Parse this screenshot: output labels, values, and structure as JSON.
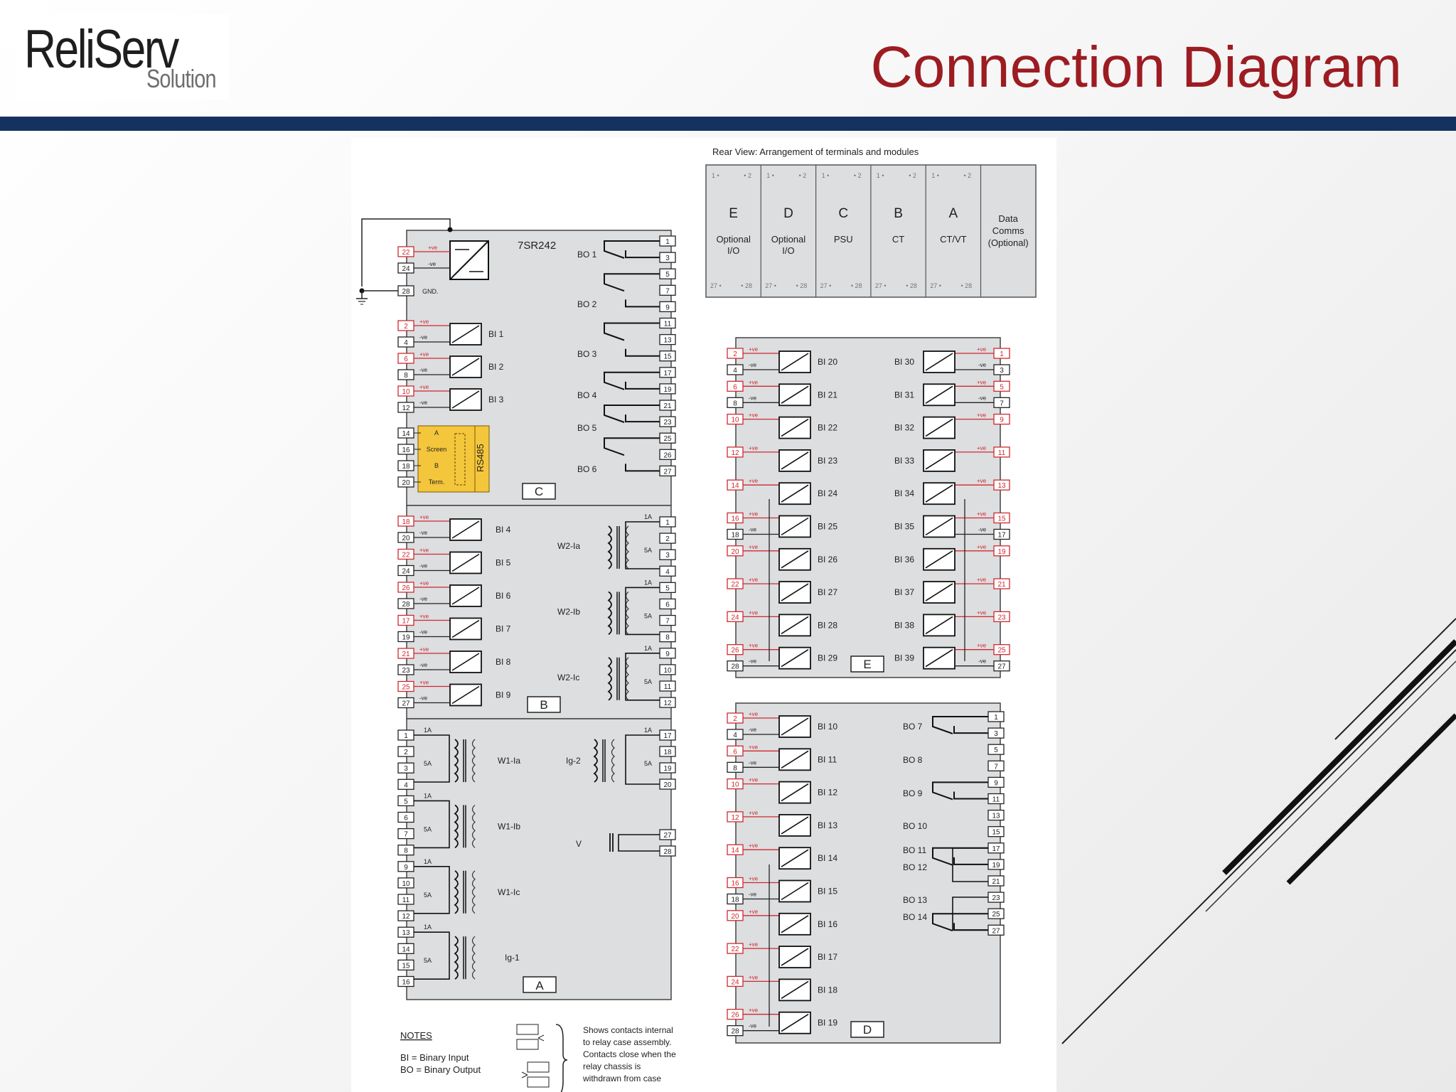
{
  "header": {
    "logo_main": "ReliServ",
    "logo_sub": "Solution",
    "title": "Connection Diagram"
  },
  "rear_view": {
    "caption": "Rear View: Arrangement of terminals and modules",
    "modules": [
      {
        "letter": "E",
        "lines": [
          "Optional",
          "I/O"
        ]
      },
      {
        "letter": "D",
        "lines": [
          "Optional",
          "I/O"
        ]
      },
      {
        "letter": "C",
        "lines": [
          "PSU"
        ]
      },
      {
        "letter": "B",
        "lines": [
          "CT"
        ]
      },
      {
        "letter": "A",
        "lines": [
          "CT/VT"
        ]
      },
      {
        "letter": "",
        "lines": [
          "Data",
          "Comms",
          "(Optional)"
        ]
      }
    ]
  },
  "relay": {
    "model": "7SR242",
    "gnd": "GND.",
    "rs485": "RS485",
    "rs485_terms": [
      {
        "n": "14",
        "t": "A"
      },
      {
        "n": "16",
        "t": "Screen"
      },
      {
        "n": "18",
        "t": "B"
      },
      {
        "n": "20",
        "t": "Term."
      }
    ],
    "psu_terms": [
      "22",
      "24",
      "28"
    ],
    "module_c": {
      "letter": "C",
      "bi": [
        {
          "n": "BI 1",
          "p": "2",
          "m": "4"
        },
        {
          "n": "BI 2",
          "p": "6",
          "m": "8"
        },
        {
          "n": "BI 3",
          "p": "10",
          "m": "12"
        }
      ],
      "bo_labels": [
        "BO 1",
        "BO 2",
        "BO 3",
        "BO 4",
        "BO 5",
        "BO 6"
      ],
      "right_terms": [
        "1",
        "3",
        "5",
        "7",
        "9",
        "11",
        "13",
        "15",
        "17",
        "19",
        "21",
        "23",
        "25",
        "26",
        "27"
      ]
    },
    "module_b": {
      "letter": "B",
      "bi": [
        {
          "n": "BI 4",
          "p": "18",
          "m": "20"
        },
        {
          "n": "BI 5",
          "p": "22",
          "m": "24"
        },
        {
          "n": "BI 6",
          "p": "26",
          "m": "28"
        },
        {
          "n": "BI 7",
          "p": "17",
          "m": "19"
        },
        {
          "n": "BI 8",
          "p": "21",
          "m": "23"
        },
        {
          "n": "BI 9",
          "p": "25",
          "m": "27"
        }
      ],
      "ct": [
        "W2-Ia",
        "W2-Ib",
        "W2-Ic"
      ],
      "right_terms": [
        "1",
        "2",
        "3",
        "4",
        "5",
        "6",
        "7",
        "8",
        "9",
        "10",
        "11",
        "12"
      ]
    },
    "module_a": {
      "letter": "A",
      "ct_left": [
        "W1-Ia",
        "W1-Ib",
        "W1-Ic",
        "Ig-1"
      ],
      "left_terms": [
        "1",
        "2",
        "3",
        "4",
        "5",
        "6",
        "7",
        "8",
        "9",
        "10",
        "11",
        "12",
        "13",
        "14",
        "15",
        "16"
      ],
      "ig2": "Ig-2",
      "v": "V",
      "right_terms": [
        "17",
        "18",
        "19",
        "20",
        "27",
        "28"
      ]
    }
  },
  "module_e": {
    "letter": "E",
    "left": [
      {
        "n": "BI 20",
        "p": "2",
        "m": "4"
      },
      {
        "n": "BI 21",
        "p": "6",
        "m": "8"
      },
      {
        "n": "BI 22",
        "p": "10",
        "m": ""
      },
      {
        "n": "BI 23",
        "p": "12",
        "m": ""
      },
      {
        "n": "BI 24",
        "p": "14",
        "m": ""
      },
      {
        "n": "BI 25",
        "p": "16",
        "m": "18"
      },
      {
        "n": "BI 26",
        "p": "20",
        "m": ""
      },
      {
        "n": "BI 27",
        "p": "22",
        "m": ""
      },
      {
        "n": "BI 28",
        "p": "24",
        "m": ""
      },
      {
        "n": "BI 29",
        "p": "26",
        "m": "28"
      }
    ],
    "right": [
      {
        "n": "BI 30",
        "p": "1",
        "m": "3"
      },
      {
        "n": "BI 31",
        "p": "5",
        "m": "7"
      },
      {
        "n": "BI 32",
        "p": "9",
        "m": ""
      },
      {
        "n": "BI 33",
        "p": "11",
        "m": ""
      },
      {
        "n": "BI 34",
        "p": "13",
        "m": ""
      },
      {
        "n": "BI 35",
        "p": "15",
        "m": "17"
      },
      {
        "n": "BI 36",
        "p": "19",
        "m": ""
      },
      {
        "n": "BI 37",
        "p": "21",
        "m": ""
      },
      {
        "n": "BI 38",
        "p": "23",
        "m": ""
      },
      {
        "n": "BI 39",
        "p": "25",
        "m": "27"
      }
    ]
  },
  "module_d": {
    "letter": "D",
    "left": [
      {
        "n": "BI 10",
        "p": "2",
        "m": "4"
      },
      {
        "n": "BI 11",
        "p": "6",
        "m": "8"
      },
      {
        "n": "BI 12",
        "p": "10",
        "m": ""
      },
      {
        "n": "BI 13",
        "p": "12",
        "m": ""
      },
      {
        "n": "BI 14",
        "p": "14",
        "m": ""
      },
      {
        "n": "BI 15",
        "p": "16",
        "m": "18"
      },
      {
        "n": "BI 16",
        "p": "20",
        "m": ""
      },
      {
        "n": "BI 17",
        "p": "22",
        "m": ""
      },
      {
        "n": "BI 18",
        "p": "24",
        "m": ""
      },
      {
        "n": "BI 19",
        "p": "26",
        "m": "28"
      }
    ],
    "bo": [
      "BO 7",
      "BO 8",
      "BO 9",
      "BO 10",
      "BO 11",
      "BO 12",
      "BO 13",
      "BO 14"
    ],
    "right_terms": [
      "1",
      "3",
      "5",
      "7",
      "9",
      "11",
      "13",
      "15",
      "17",
      "19",
      "21",
      "23",
      "25",
      "27"
    ]
  },
  "labels": {
    "pos": "+ve",
    "neg": "-ve",
    "a1": "1A",
    "a5": "5A"
  },
  "notes": {
    "heading": "NOTES",
    "bi": "BI = Binary Input",
    "bo": "BO = Binary Output",
    "contacts": [
      "Shows contacts internal",
      "to relay case assembly.",
      "Contacts close when the",
      "relay chassis is",
      "withdrawn from case"
    ]
  },
  "colors": {
    "title": "#9c1c22",
    "bar": "#15315f",
    "panel": "#dcdee0",
    "accent_red": "#d0292f",
    "rs485": "#f4c63c"
  }
}
